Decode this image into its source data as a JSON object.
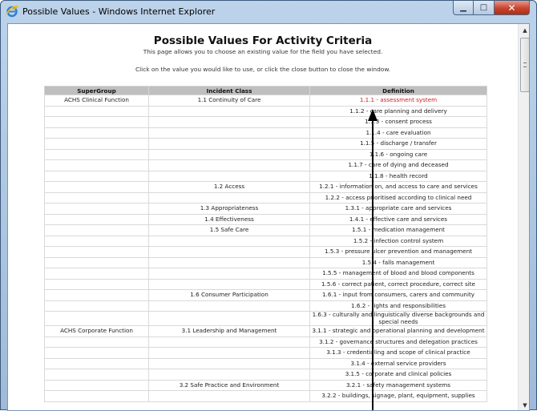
{
  "window": {
    "title": "Possible Values - Windows Internet Explorer",
    "minimize_glyph": "▁",
    "maximize_glyph": "□",
    "close_glyph": "✕"
  },
  "page": {
    "title": "Possible Values For Activity Criteria",
    "subtitle": "This page allows you to choose an existing value for the field you have selected.",
    "instruction": "Click on the value you would like to use, or click the close button to close the window."
  },
  "table": {
    "headers": [
      "SuperGroup",
      "Incident Class",
      "Definition"
    ],
    "rows": [
      {
        "supergroup": "ACHS Clinical Function",
        "incident_class": "1.1 Continuity of Care",
        "definition": "1.1.1 - assessment system",
        "selected": true
      },
      {
        "supergroup": "",
        "incident_class": "",
        "definition": "1.1.2 - care planning and delivery"
      },
      {
        "supergroup": "",
        "incident_class": "",
        "definition": "1.1.3 - consent process"
      },
      {
        "supergroup": "",
        "incident_class": "",
        "definition": "1.1.4 - care evaluation"
      },
      {
        "supergroup": "",
        "incident_class": "",
        "definition": "1.1.5 - discharge / transfer"
      },
      {
        "supergroup": "",
        "incident_class": "",
        "definition": "1.1.6 - ongoing care"
      },
      {
        "supergroup": "",
        "incident_class": "",
        "definition": "1.1.7 - care of dying and deceased"
      },
      {
        "supergroup": "",
        "incident_class": "",
        "definition": "1.1.8 - health record"
      },
      {
        "supergroup": "",
        "incident_class": "1.2 Access",
        "definition": "1.2.1 - information on, and access to care and services"
      },
      {
        "supergroup": "",
        "incident_class": "",
        "definition": "1.2.2 - access prioritised according to clinical need"
      },
      {
        "supergroup": "",
        "incident_class": "1.3 Appropriateness",
        "definition": "1.3.1 - appropriate care and services"
      },
      {
        "supergroup": "",
        "incident_class": "1.4 Effectiveness",
        "definition": "1.4.1 - effective care and services"
      },
      {
        "supergroup": "",
        "incident_class": "1.5 Safe Care",
        "definition": "1.5.1 - medication management"
      },
      {
        "supergroup": "",
        "incident_class": "",
        "definition": "1.5.2 - infection control system"
      },
      {
        "supergroup": "",
        "incident_class": "",
        "definition": "1.5.3 - pressure ulcer prevention and management"
      },
      {
        "supergroup": "",
        "incident_class": "",
        "definition": "1.5.4 - falls management"
      },
      {
        "supergroup": "",
        "incident_class": "",
        "definition": "1.5.5 - management of blood and blood components"
      },
      {
        "supergroup": "",
        "incident_class": "",
        "definition": "1.5.6 - correct patient, correct procedure, correct site"
      },
      {
        "supergroup": "",
        "incident_class": "1.6 Consumer Participation",
        "definition": "1.6.1 - input from consumers, carers and community"
      },
      {
        "supergroup": "",
        "incident_class": "",
        "definition": "1.6.2 - rights and responsibilities"
      },
      {
        "supergroup": "",
        "incident_class": "",
        "definition": "1.6.3 - culturally and linguistically diverse backgrounds and special needs"
      },
      {
        "supergroup": "ACHS Corporate Function",
        "incident_class": "3.1 Leadership and Management",
        "definition": "3.1.1 - strategic and operational planning and development"
      },
      {
        "supergroup": "",
        "incident_class": "",
        "definition": "3.1.2 - governance structures and delegation practices"
      },
      {
        "supergroup": "",
        "incident_class": "",
        "definition": "3.1.3 - credentialing and scope of clinical practice"
      },
      {
        "supergroup": "",
        "incident_class": "",
        "definition": "3.1.4 - external service providers"
      },
      {
        "supergroup": "",
        "incident_class": "",
        "definition": "3.1.5 - corporate and clinical policies"
      },
      {
        "supergroup": "",
        "incident_class": "3.2 Safe Practice and Environment",
        "definition": "3.2.1 - safety management systems"
      },
      {
        "supergroup": "",
        "incident_class": "",
        "definition": "3.2.2 - buildings, signage, plant, equipment, supplies"
      }
    ]
  },
  "colors": {
    "selected_text": "#d21d1d",
    "header_bg": "#bfbfbf",
    "arrow": "#000000"
  },
  "icons": [
    "ie-icon",
    "minimize-icon",
    "maximize-icon",
    "close-icon",
    "scroll-up-icon",
    "scroll-down-icon"
  ]
}
